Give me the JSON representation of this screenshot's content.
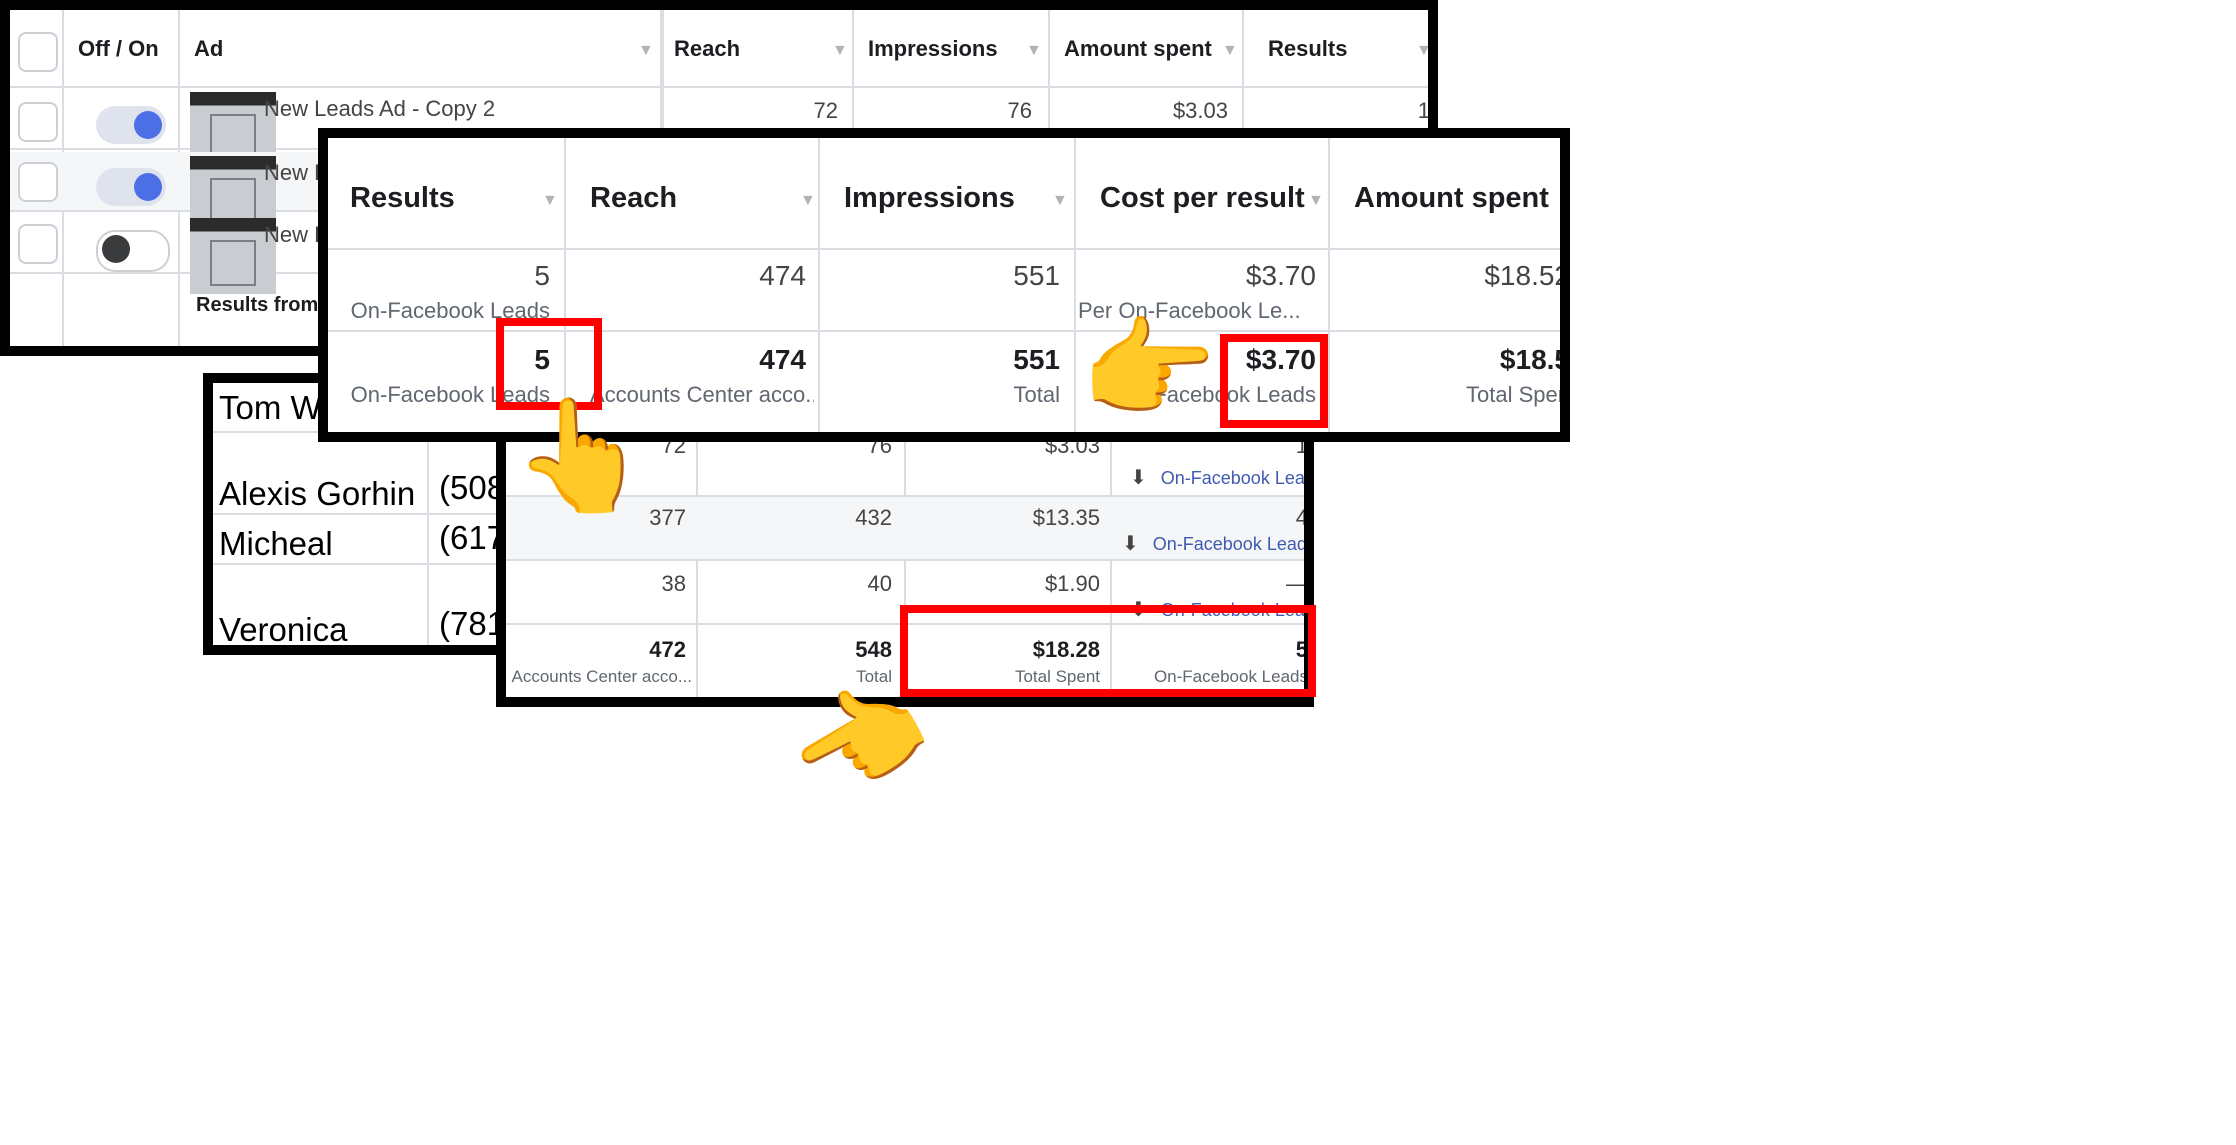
{
  "ads_panel": {
    "columns": {
      "toggle": "Off / On",
      "ad": "Ad",
      "reach": "Reach",
      "impressions": "Impressions",
      "amount_spent": "Amount spent",
      "results": "Results"
    },
    "rows": [
      {
        "name": "New Leads Ad - Copy 2",
        "on": true,
        "reach": "72",
        "impressions": "76",
        "amount_spent": "$3.03",
        "results": "1",
        "result_type": "On-Facebook Lead"
      },
      {
        "name": "New Le",
        "on": true
      },
      {
        "name": "New Le",
        "on": false
      }
    ],
    "footer_label": "Results from 3"
  },
  "summary_panel": {
    "columns": {
      "results": "Results",
      "reach": "Reach",
      "impressions": "Impressions",
      "cost_per_result": "Cost per result",
      "amount_spent": "Amount spent"
    },
    "row1": {
      "results": "5",
      "results_sub": "On-Facebook Leads",
      "reach": "474",
      "impressions": "551",
      "cost_per_result": "$3.70",
      "cost_sub": "Per On-Facebook Le...",
      "amount_spent": "$18.52"
    },
    "row2": {
      "results": "5",
      "results_sub": "On-Facebook Leads",
      "reach": "474",
      "reach_sub": "Accounts Center acco...",
      "impressions": "551",
      "impressions_sub": "Total",
      "cost_per_result": "$3.70",
      "cost_sub": "On-Facebook Leads",
      "amount_spent": "$18.5",
      "amount_sub": "Total Spen"
    }
  },
  "contacts_panel": {
    "rows": [
      {
        "name": "Tom Wil",
        "phone": ""
      },
      {
        "name": "Alexis Gorhin",
        "phone": "(508"
      },
      {
        "name": "Micheal",
        "phone": "(617"
      },
      {
        "name": "Veronica",
        "phone": "(781"
      }
    ]
  },
  "bottom_panel": {
    "rows": [
      {
        "reach": "72",
        "impressions": "76",
        "amount_spent": "$3.03",
        "results": "1",
        "result_type": "On-Facebook Lead"
      },
      {
        "reach": "377",
        "impressions": "432",
        "amount_spent": "$13.35",
        "results": "4",
        "result_type": "On-Facebook Leads"
      },
      {
        "reach": "38",
        "impressions": "40",
        "amount_spent": "$1.90",
        "results": "—",
        "result_type": "On-Facebook Lead"
      }
    ],
    "totals": {
      "reach": "472",
      "reach_sub": "Accounts Center acco...",
      "impressions": "548",
      "impressions_sub": "Total",
      "amount_spent": "$18.28",
      "amount_sub": "Total Spent",
      "results": "5",
      "results_sub": "On-Facebook Leads"
    }
  },
  "pointers": {
    "up": "👆",
    "right": "👉",
    "left": "👈"
  },
  "colors": {
    "highlight": "#ff0000",
    "toggle_on": "#4d6fe6",
    "link": "#3f5ab0"
  }
}
